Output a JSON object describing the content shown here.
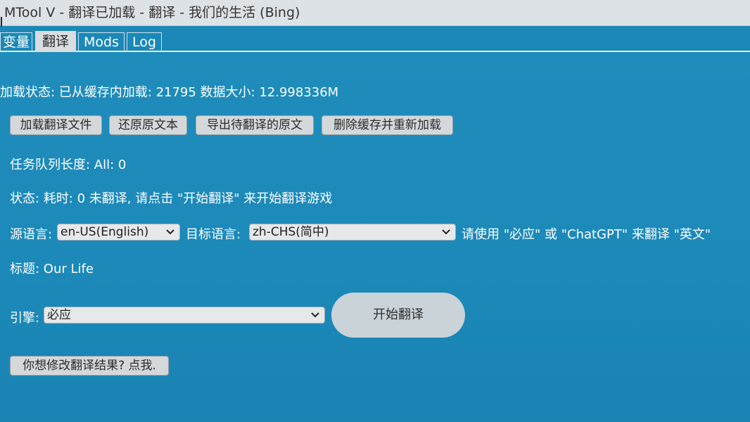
{
  "window": {
    "title": "MTool V - 翻译已加载 - 翻译 - 我们的生活 (Bing)"
  },
  "tabs": [
    {
      "label": "变量",
      "active": false
    },
    {
      "label": "翻译",
      "active": true
    },
    {
      "label": "Mods",
      "active": false
    },
    {
      "label": "Log",
      "active": false
    }
  ],
  "load_status": "加载状态: 已从缓存内加载: 21795 数据大小: 12.998336M",
  "buttons": {
    "load_file": "加载翻译文件",
    "restore": "还原原文本",
    "export": "导出待翻译的原文",
    "delete_reload": "删除缓存并重新加载"
  },
  "queue_length": "任务队列长度: All: 0",
  "status_text": "状态: 耗时: 0 未翻译, 请点击 \"开始翻译\" 来开始翻译游戏",
  "language": {
    "source_label": "源语言:",
    "source_value": "en-US(English)",
    "target_label": "目标语言:",
    "target_value": "zh-CHS(简中)",
    "hint": "请使用 \"必应\" 或 \"ChatGPT\" 来翻译 \"英文\""
  },
  "title_line": "标题: Our Life",
  "engine": {
    "label": "引擎:",
    "value": "必应"
  },
  "start_button": "开始翻译",
  "edit_button": "你想修改翻译结果? 点我.",
  "colors": {
    "background": "#1d8ab8",
    "button": "#d4d8db",
    "pill": "#c9d3d8"
  }
}
